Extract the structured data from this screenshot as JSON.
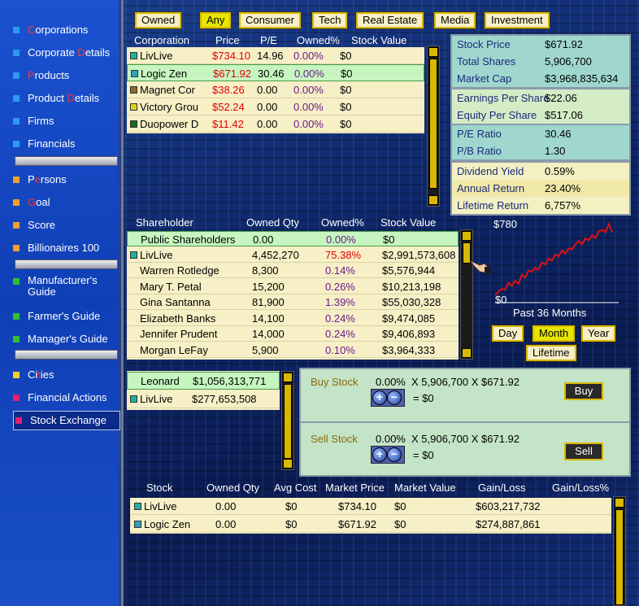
{
  "sidebar": {
    "items": [
      {
        "label": "Corporations",
        "accent": "C",
        "color": "#2a9af0"
      },
      {
        "label": "Corporate Details",
        "accent": "D",
        "color": "#2a9af0"
      },
      {
        "label": "Products",
        "accent": "P",
        "color": "#2a9af0"
      },
      {
        "label": "Product Details",
        "accent": "D",
        "color": "#2a9af0"
      },
      {
        "label": "Firms",
        "accent": "",
        "color": "#2a9af0"
      },
      {
        "label": "Financials",
        "accent": "",
        "color": "#2a9af0"
      },
      {
        "label": "Persons",
        "accent": "e",
        "color": "#f0a030"
      },
      {
        "label": "Goal",
        "accent": "G",
        "color": "#f0a030"
      },
      {
        "label": "Score",
        "accent": "",
        "color": "#f0a030"
      },
      {
        "label": "Billionaires 100",
        "accent": "",
        "color": "#f0a030"
      },
      {
        "label": "Manufacturer's Guide",
        "accent": "",
        "color": "#30c030"
      },
      {
        "label": "Farmer's Guide",
        "accent": "",
        "color": "#30c030"
      },
      {
        "label": "Manager's Guide",
        "accent": "",
        "color": "#30c030"
      },
      {
        "label": "Cities",
        "accent": "t",
        "color": "#f0d030"
      },
      {
        "label": "Financial Actions",
        "accent": "",
        "color": "#e02070"
      },
      {
        "label": "Stock Exchange",
        "accent": "",
        "color": "#e02070"
      }
    ]
  },
  "filters": {
    "tabs": [
      "Owned",
      "Any",
      "Consumer",
      "Tech",
      "Real Estate",
      "Media",
      "Investment"
    ],
    "selected": "Any"
  },
  "corporations": {
    "headers": [
      "Corporation",
      "Price",
      "P/E",
      "Owned%",
      "Stock Value"
    ],
    "rows": [
      {
        "name": "LivLive",
        "price": "$734.10",
        "pe": "14.96",
        "owned": "0.00%",
        "value": "$0",
        "color": "#20b0a0"
      },
      {
        "name": "Logic Zen",
        "price": "$671.92",
        "pe": "30.46",
        "owned": "0.00%",
        "value": "$0",
        "color": "#30a0c0"
      },
      {
        "name": "Magnet Cor",
        "price": "$38.26",
        "pe": "0.00",
        "owned": "0.00%",
        "value": "$0",
        "color": "#8a6a30"
      },
      {
        "name": "Victory Grou",
        "price": "$52.24",
        "pe": "0.00",
        "owned": "0.00%",
        "value": "$0",
        "color": "#e0d020"
      },
      {
        "name": "Duopower D",
        "price": "$11.42",
        "pe": "0.00",
        "owned": "0.00%",
        "value": "$0",
        "color": "#1a6a1a"
      }
    ]
  },
  "stock_info": {
    "group1": [
      {
        "k": "Stock Price",
        "v": "$671.92"
      },
      {
        "k": "Total Shares",
        "v": "5,906,700"
      },
      {
        "k": "Market Cap",
        "v": "$3,968,835,634"
      }
    ],
    "group2": [
      {
        "k": "Earnings Per Share",
        "v": "$22.06"
      },
      {
        "k": "Equity Per Share",
        "v": "$517.06"
      }
    ],
    "group3": [
      {
        "k": "P/E Ratio",
        "v": "30.46"
      },
      {
        "k": "P/B Ratio",
        "v": "1.30"
      }
    ],
    "group4": [
      {
        "k": "Dividend Yield",
        "v": "0.59%"
      },
      {
        "k": "Annual Return",
        "v": "23.40%"
      },
      {
        "k": "Lifetime Return",
        "v": "6,757%"
      }
    ]
  },
  "shareholders": {
    "headers": [
      "Shareholder",
      "Owned Qty",
      "Owned%",
      "Stock Value"
    ],
    "rows": [
      {
        "name": "Public Shareholders",
        "qty": "0.00",
        "pct": "0.00%",
        "value": "$0",
        "icon": ""
      },
      {
        "name": "LivLive",
        "qty": "4,452,270",
        "pct": "75.38%",
        "value": "$2,991,573,608",
        "icon": "#20b0a0"
      },
      {
        "name": "Warren Rotledge",
        "qty": "8,300",
        "pct": "0.14%",
        "value": "$5,576,944",
        "icon": ""
      },
      {
        "name": "Mary T. Petal",
        "qty": "15,200",
        "pct": "0.26%",
        "value": "$10,213,198",
        "icon": ""
      },
      {
        "name": "Gina Santanna",
        "qty": "81,900",
        "pct": "1.39%",
        "value": "$55,030,328",
        "icon": ""
      },
      {
        "name": "Elizabeth Banks",
        "qty": "14,100",
        "pct": "0.24%",
        "value": "$9,474,085",
        "icon": ""
      },
      {
        "name": "Jennifer Prudent",
        "qty": "14,000",
        "pct": "0.24%",
        "value": "$9,406,893",
        "icon": ""
      },
      {
        "name": "Morgan LeFay",
        "qty": "5,900",
        "pct": "0.10%",
        "value": "$3,964,333",
        "icon": ""
      }
    ]
  },
  "price_chart": {
    "max_label": "$780",
    "min_label": "$0",
    "period_label": "Past 36 Months",
    "buttons": [
      "Day",
      "Month",
      "Year",
      "Lifetime"
    ],
    "selected": "Month"
  },
  "chart_data": {
    "type": "line",
    "ylim": [
      0,
      780
    ],
    "series": [
      {
        "values": [
          60,
          90,
          120,
          110,
          180,
          150,
          200,
          170,
          260,
          230,
          300,
          290,
          330,
          310,
          380,
          360,
          420,
          400,
          460,
          440,
          500,
          470,
          520,
          510,
          560,
          590,
          560,
          620,
          600,
          650,
          620,
          690,
          700,
          680,
          760,
          680
        ]
      }
    ]
  },
  "players": [
    {
      "name": "Leonard",
      "value": "$1,056,313,771",
      "icon": ""
    },
    {
      "name": "LivLive",
      "value": "$277,653,508",
      "icon": "#20b0a0"
    }
  ],
  "trade": {
    "buy_label": "Buy Stock",
    "buy_pct": "0.00%",
    "buy_formula": "X 5,906,700 X $671.92",
    "buy_result": "= $0",
    "buy_button": "Buy",
    "sell_label": "Sell Stock",
    "sell_pct": "0.00%",
    "sell_formula": "X 5,906,700 X $671.92",
    "sell_result": "= $0",
    "sell_button": "Sell"
  },
  "portfolio": {
    "headers": [
      "Stock",
      "Owned Qty",
      "Avg Cost",
      "Market Price",
      "Market Value",
      "Gain/Loss",
      "Gain/Loss%"
    ],
    "rows": [
      {
        "name": "LivLive",
        "qty": "0.00",
        "avg": "$0",
        "price": "$734.10",
        "value": "$0",
        "gain": "$603,217,732",
        "pct": "",
        "color": "#20b0a0"
      },
      {
        "name": "Logic Zen",
        "qty": "0.00",
        "avg": "$0",
        "price": "$671.92",
        "value": "$0",
        "gain": "$274,887,861",
        "pct": "",
        "color": "#30a0c0"
      }
    ]
  }
}
